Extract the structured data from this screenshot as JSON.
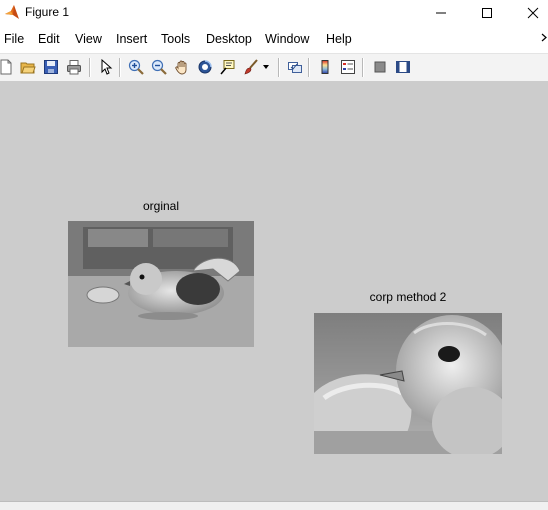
{
  "window": {
    "title": "Figure 1"
  },
  "menu": [
    "File",
    "Edit",
    "View",
    "Insert",
    "Tools",
    "Desktop",
    "Window",
    "Help"
  ],
  "toolbar_icons": [
    "new-figure-icon",
    "open-file-icon",
    "save-icon",
    "print-icon",
    "edit-plot-icon",
    "zoom-in-icon",
    "zoom-out-icon",
    "pan-icon",
    "rotate-3d-icon",
    "data-cursor-icon",
    "brush-icon",
    "brush-dropdown-icon",
    "link-plot-icon",
    "insert-colorbar-icon",
    "insert-legend-icon",
    "hide-plot-tools-icon",
    "show-plot-tools-icon"
  ],
  "axes": [
    {
      "title": "orginal"
    },
    {
      "title": "corp method 2"
    }
  ]
}
